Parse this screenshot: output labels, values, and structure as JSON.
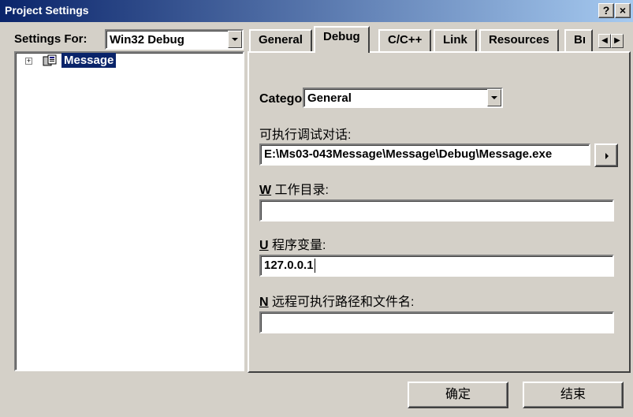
{
  "window": {
    "title": "Project Settings",
    "help_glyph": "?",
    "close_glyph": "×"
  },
  "left": {
    "settings_label": "Settings For:",
    "settings_value": "Win32 Debug",
    "tree": [
      {
        "label": "Message",
        "expander": "+"
      }
    ]
  },
  "tabs": [
    "General",
    "Debug",
    "C/C++",
    "Link",
    "Resources",
    "Bı"
  ],
  "active_tab": "Debug",
  "debug": {
    "category_label": "Category:",
    "category_value": "General",
    "exe_label": "可执行调试对话:",
    "exe_value": "E:\\Ms03-043Message\\Message\\Debug\\Message.exe",
    "workdir_label_key": "W",
    "workdir_label": " 工作目录:",
    "workdir_value": "",
    "args_label_key": "U",
    "args_label": " 程序变量:",
    "args_value": "127.0.0.1",
    "remote_label_key": "N",
    "remote_label": " 远程可执行路径和文件名:",
    "remote_value": ""
  },
  "buttons": {
    "ok": "确定",
    "cancel": "结束"
  }
}
